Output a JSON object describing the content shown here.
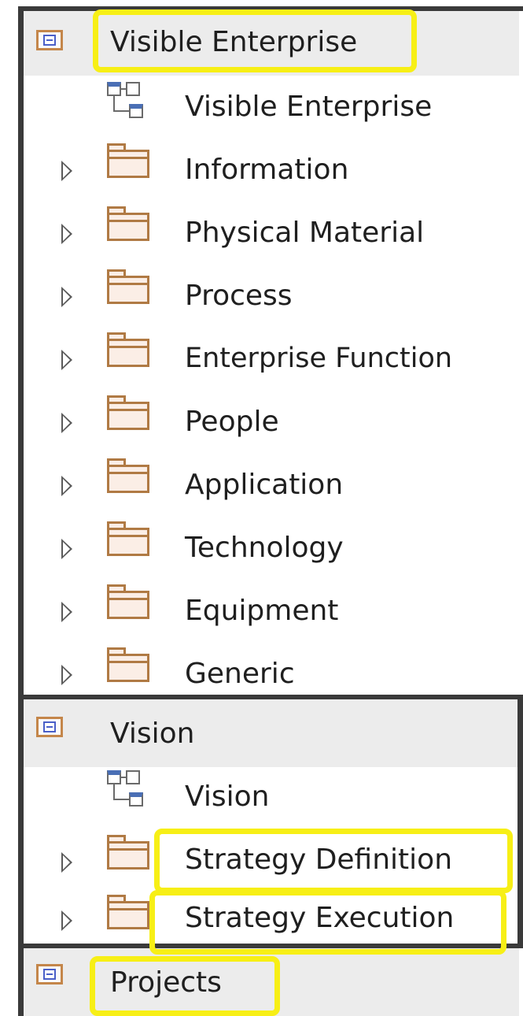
{
  "tree": {
    "sections": [
      {
        "label": "Visible Enterprise",
        "items": [
          {
            "label": "Visible Enterprise",
            "icon": "diagram-icon",
            "expandable": false
          },
          {
            "label": "Information",
            "icon": "folder-icon",
            "expandable": true
          },
          {
            "label": "Physical Material",
            "icon": "folder-icon",
            "expandable": true
          },
          {
            "label": "Process",
            "icon": "folder-icon",
            "expandable": true
          },
          {
            "label": "Enterprise Function",
            "icon": "folder-icon",
            "expandable": true
          },
          {
            "label": "People",
            "icon": "folder-icon",
            "expandable": true
          },
          {
            "label": "Application",
            "icon": "folder-icon",
            "expandable": true
          },
          {
            "label": "Technology",
            "icon": "folder-icon",
            "expandable": true
          },
          {
            "label": "Equipment",
            "icon": "folder-icon",
            "expandable": true
          },
          {
            "label": "Generic",
            "icon": "folder-icon",
            "expandable": true
          }
        ]
      },
      {
        "label": "Vision",
        "items": [
          {
            "label": "Vision",
            "icon": "diagram-icon",
            "expandable": false
          },
          {
            "label": "Strategy Definition",
            "icon": "folder-icon",
            "expandable": true
          },
          {
            "label": "Strategy Execution",
            "icon": "folder-icon",
            "expandable": true
          }
        ]
      },
      {
        "label": "Projects",
        "items": []
      }
    ]
  },
  "colors": {
    "highlight": "#f7ef16",
    "header_background": "#ececec",
    "folder_stroke": "#b07a44",
    "folder_fill": "#fbeee6",
    "frame": "#3a3a3a"
  }
}
